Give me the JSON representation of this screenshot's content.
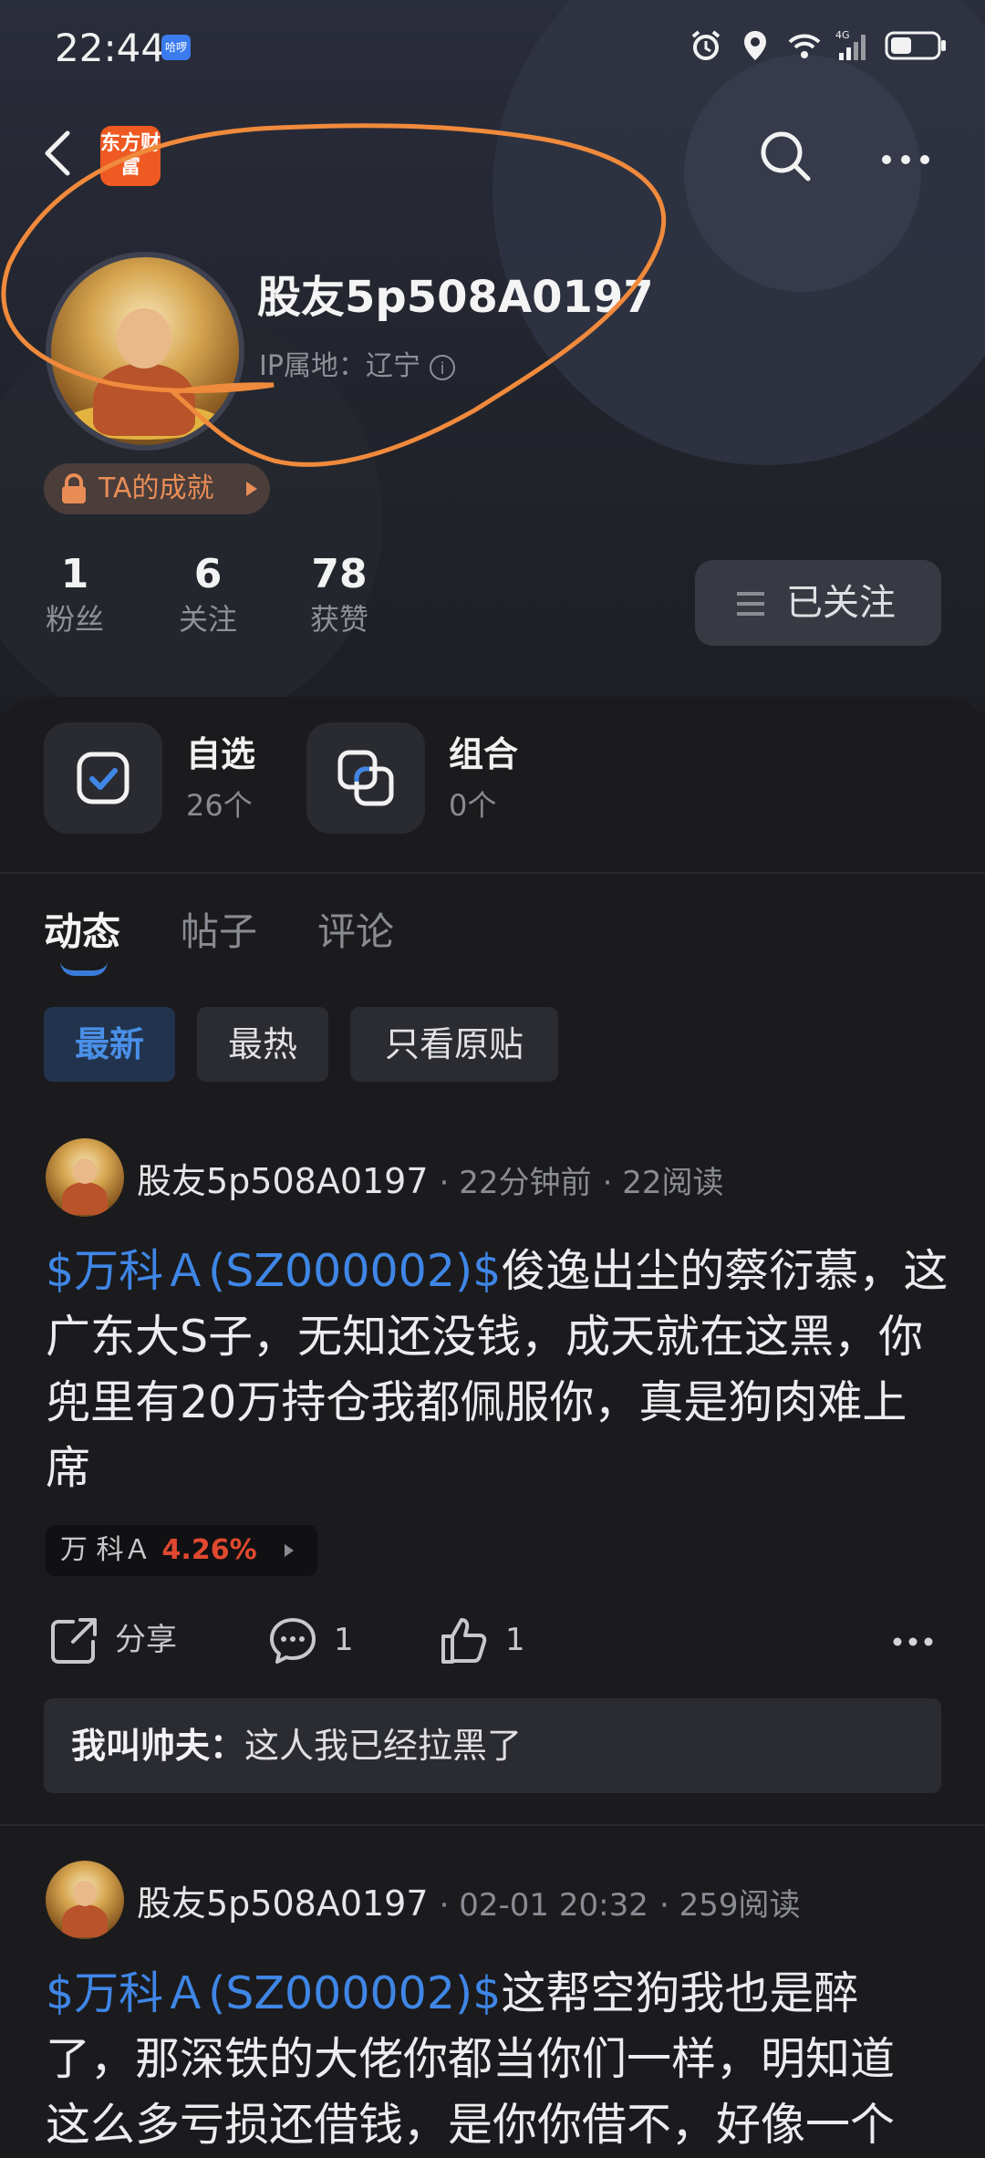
{
  "status_bar": {
    "time": "22:44",
    "hd_badge": "哈啰",
    "icons": [
      "alarm-icon",
      "location-icon",
      "wifi-icon",
      "signal-4g-icon",
      "battery-icon"
    ],
    "signal_label": "4G"
  },
  "nav": {
    "app_logo_text": "东方财富",
    "icons": [
      "back-icon",
      "search-icon",
      "more-icon"
    ]
  },
  "profile": {
    "username": "股友5p508A0197",
    "ip_label": "IP属地：辽宁",
    "achievements_label": "TA的成就",
    "stats": [
      {
        "value": "1",
        "label": "粉丝"
      },
      {
        "value": "6",
        "label": "关注"
      },
      {
        "value": "78",
        "label": "获赞"
      }
    ],
    "follow_button": "已关注"
  },
  "watchlists": [
    {
      "title": "自选",
      "sub": "26个",
      "icon": "watchlist-check-icon"
    },
    {
      "title": "组合",
      "sub": "0个",
      "icon": "portfolio-icon"
    }
  ],
  "tabs": [
    {
      "label": "动态",
      "active": true
    },
    {
      "label": "帖子",
      "active": false
    },
    {
      "label": "评论",
      "active": false
    }
  ],
  "filters": [
    {
      "label": "最新",
      "active": true
    },
    {
      "label": "最热",
      "active": false
    },
    {
      "label": "只看原贴",
      "active": false
    }
  ],
  "posts": [
    {
      "author": "股友5p508A0197",
      "time": "22分钟前",
      "reads": "22阅读",
      "stock_link": "$万科Ａ(SZ000002)$",
      "text": "俊逸出尘的蔡衍慕，这广东大S子，无知还没钱，成天就在这黑，你兜里有20万持仓我都佩服你，真是狗肉难上席",
      "stock_tag": {
        "name": "万 科Ａ",
        "change": "4.26%"
      },
      "actions": {
        "share": "分享",
        "comments": "1",
        "likes": "1"
      },
      "top_comment": {
        "author": "我叫帅夫：",
        "text": "这人我已经拉黑了"
      }
    },
    {
      "author": "股友5p508A0197",
      "time": "02-01 20:32",
      "reads": "259阅读",
      "stock_link": "$万科Ａ(SZ000002)$",
      "text_line1": "这帮空狗我也是醉",
      "text_line2": "了，那深铁的大佬你都当你们一样，明知道",
      "text_line3": "这么多亏损还借钱，是你你借不，好像一个"
    }
  ],
  "colors": {
    "accent_blue": "#3f86e6",
    "stock_up_red": "#e0492f",
    "annotation_orange": "#f08a3c",
    "achievement_orange": "#e98d57"
  }
}
